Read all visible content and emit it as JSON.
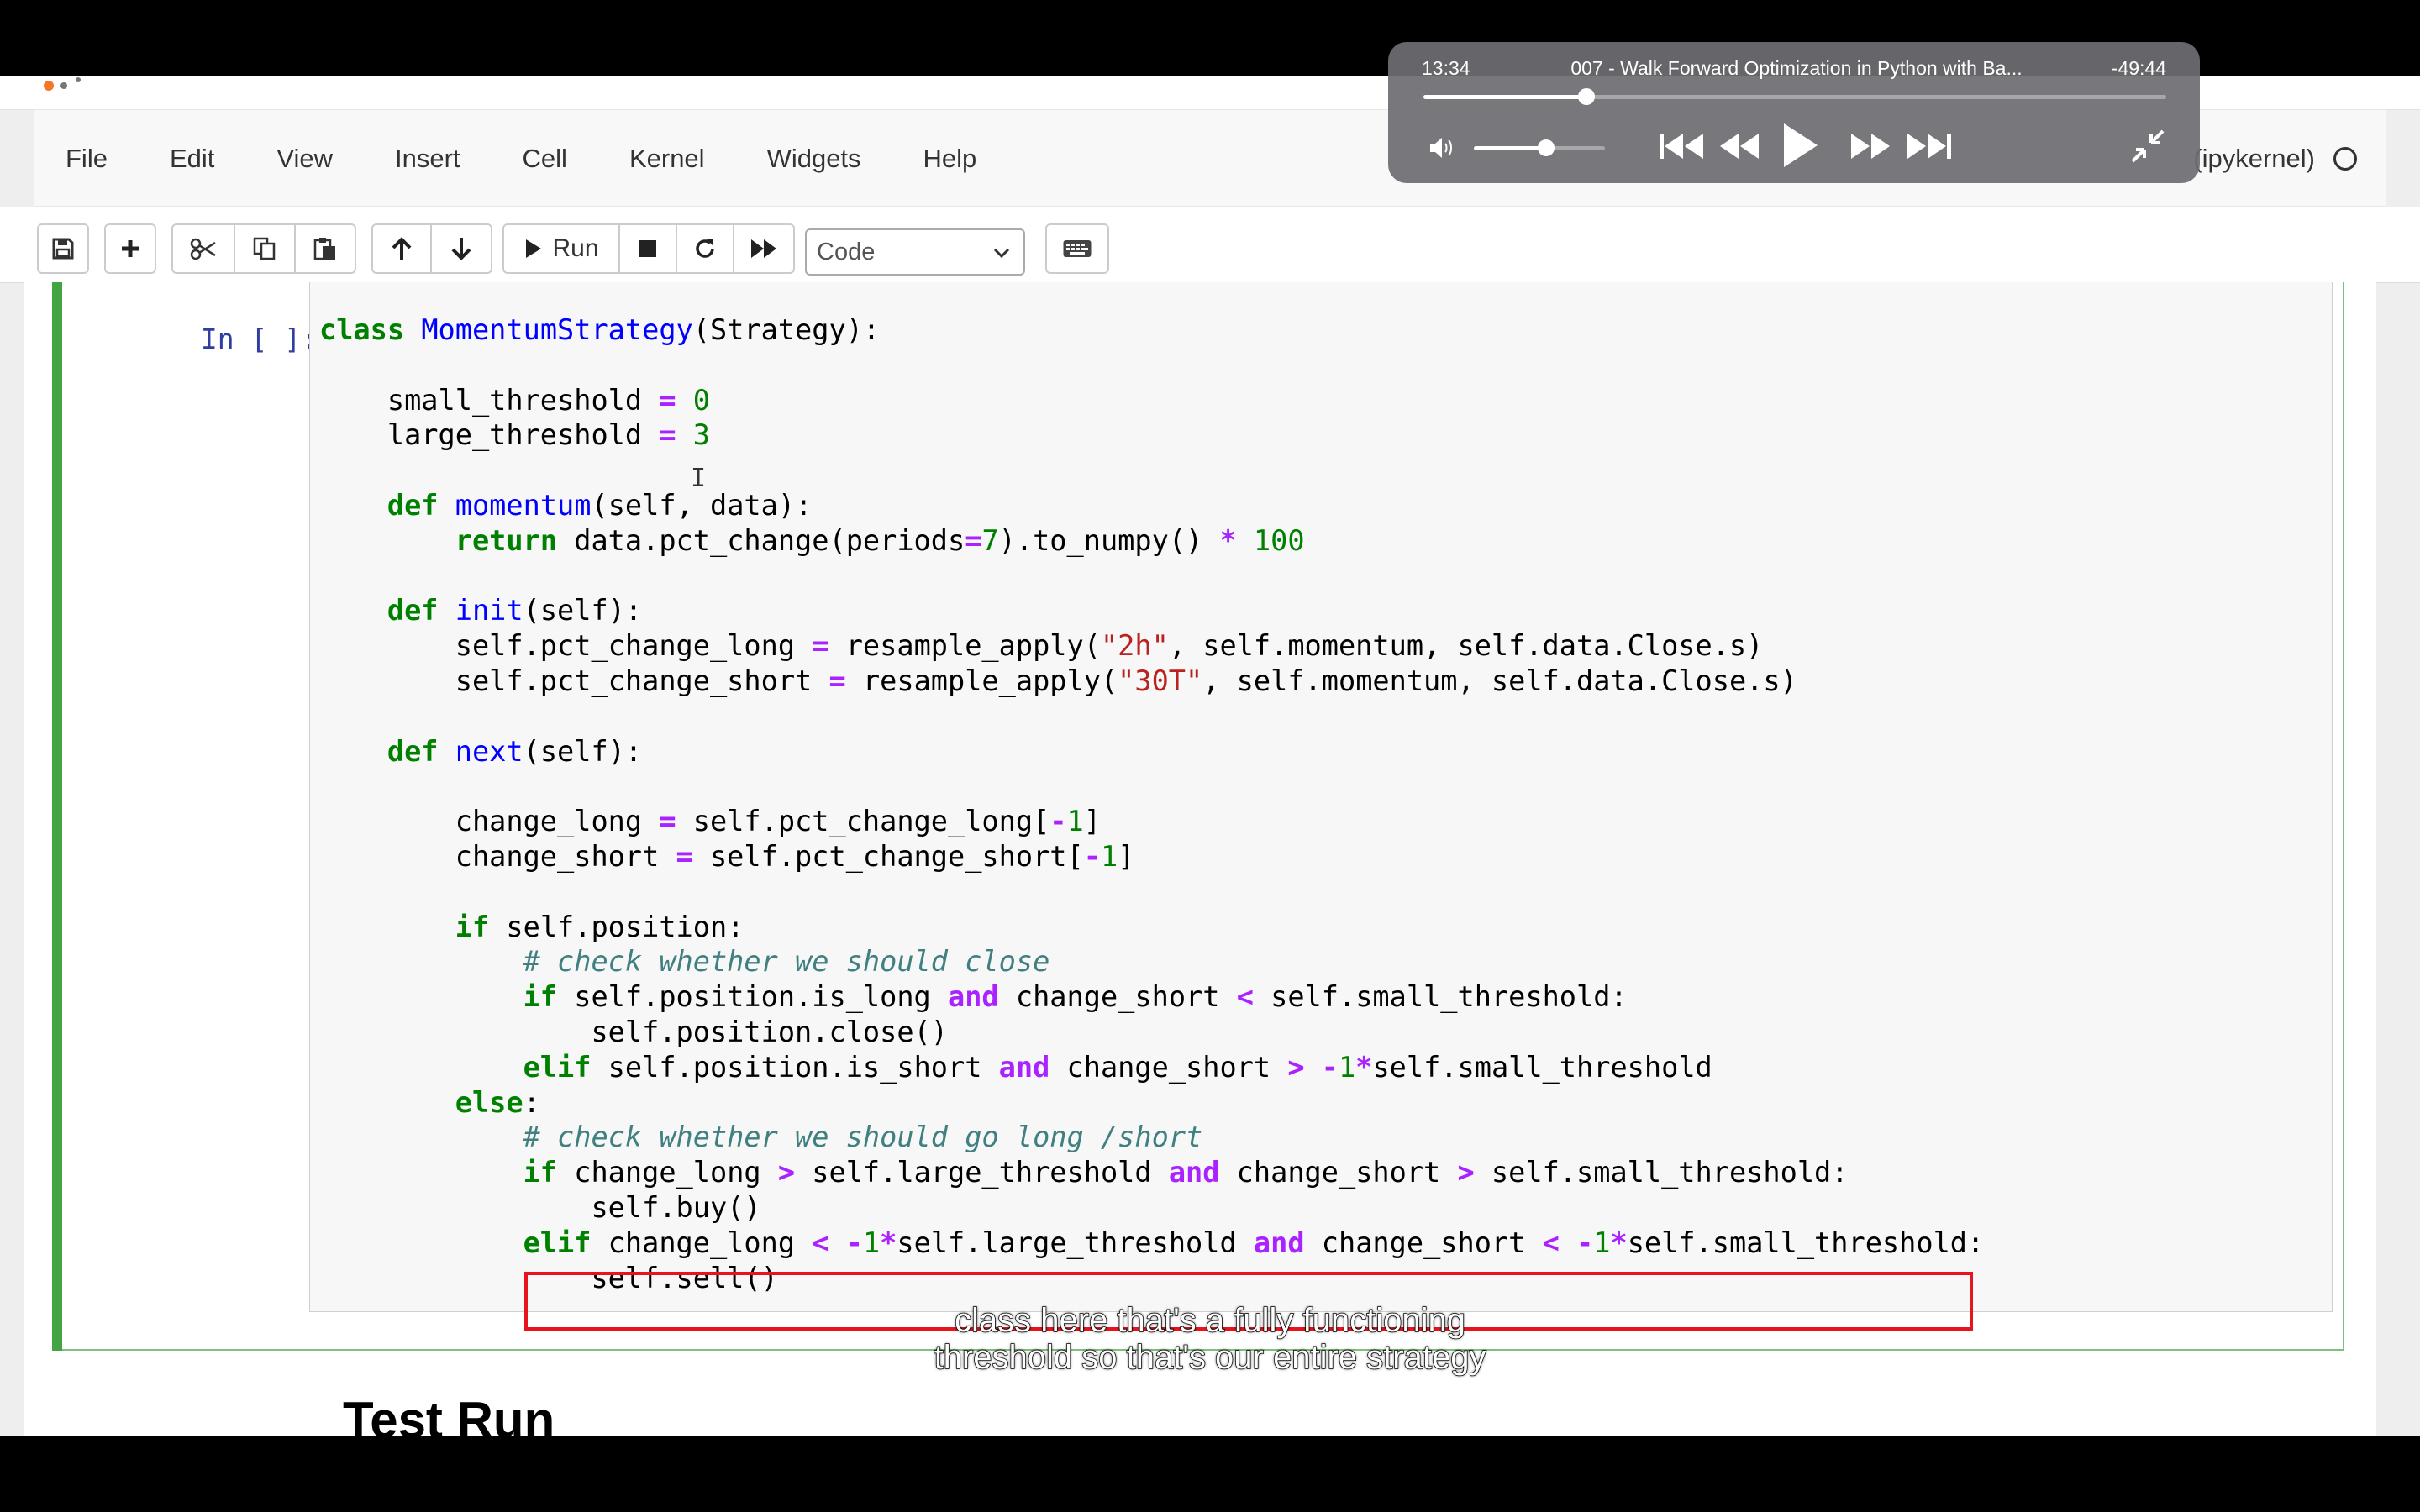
{
  "menu": [
    "File",
    "Edit",
    "View",
    "Insert",
    "Cell",
    "Kernel",
    "Widgets",
    "Help"
  ],
  "kernel": {
    "label": "(ipykernel)"
  },
  "toolbar": {
    "run_label": "Run",
    "cell_type": "Code",
    "icons": [
      "save-icon",
      "add-cell-icon",
      "cut-icon",
      "copy-icon",
      "paste-icon",
      "move-up-icon",
      "move-down-icon",
      "run-icon",
      "stop-icon",
      "restart-icon",
      "fast-forward-icon",
      "keyboard-icon"
    ]
  },
  "cell": {
    "prompt": "In [ ]:",
    "lines": [
      [
        [
          "kw",
          "class"
        ],
        [
          "t",
          " "
        ],
        [
          "fn",
          "MomentumStrategy"
        ],
        [
          "t",
          "(Strategy):"
        ]
      ],
      [],
      [
        [
          "t",
          "    small_threshold "
        ],
        [
          "op",
          "="
        ],
        [
          "t",
          " "
        ],
        [
          "num",
          "0"
        ]
      ],
      [
        [
          "t",
          "    large_threshold "
        ],
        [
          "op",
          "="
        ],
        [
          "t",
          " "
        ],
        [
          "num",
          "3"
        ]
      ],
      [],
      [
        [
          "t",
          "    "
        ],
        [
          "kw",
          "def"
        ],
        [
          "t",
          " "
        ],
        [
          "fn",
          "momentum"
        ],
        [
          "t",
          "(self, data):"
        ]
      ],
      [
        [
          "t",
          "        "
        ],
        [
          "kw",
          "return"
        ],
        [
          "t",
          " data.pct_change(periods"
        ],
        [
          "op",
          "="
        ],
        [
          "num",
          "7"
        ],
        [
          "t",
          ").to_numpy() "
        ],
        [
          "op",
          "*"
        ],
        [
          "t",
          " "
        ],
        [
          "num",
          "100"
        ]
      ],
      [],
      [
        [
          "t",
          "    "
        ],
        [
          "kw",
          "def"
        ],
        [
          "t",
          " "
        ],
        [
          "fn",
          "init"
        ],
        [
          "t",
          "(self):"
        ]
      ],
      [
        [
          "t",
          "        self.pct_change_long "
        ],
        [
          "op",
          "="
        ],
        [
          "t",
          " resample_apply("
        ],
        [
          "str",
          "\"2h\""
        ],
        [
          "t",
          ", self.momentum, self.data.Close.s)"
        ]
      ],
      [
        [
          "t",
          "        self.pct_change_short "
        ],
        [
          "op",
          "="
        ],
        [
          "t",
          " resample_apply("
        ],
        [
          "str",
          "\"30T\""
        ],
        [
          "t",
          ", self.momentum, self.data.Close.s)"
        ]
      ],
      [],
      [
        [
          "t",
          "    "
        ],
        [
          "kw",
          "def"
        ],
        [
          "t",
          " "
        ],
        [
          "fn",
          "next"
        ],
        [
          "t",
          "(self):"
        ]
      ],
      [],
      [
        [
          "t",
          "        change_long "
        ],
        [
          "op",
          "="
        ],
        [
          "t",
          " self.pct_change_long["
        ],
        [
          "op",
          "-"
        ],
        [
          "num",
          "1"
        ],
        [
          "t",
          "]"
        ]
      ],
      [
        [
          "t",
          "        change_short "
        ],
        [
          "op",
          "="
        ],
        [
          "t",
          " self.pct_change_short["
        ],
        [
          "op",
          "-"
        ],
        [
          "num",
          "1"
        ],
        [
          "t",
          "]"
        ]
      ],
      [],
      [
        [
          "t",
          "        "
        ],
        [
          "kw",
          "if"
        ],
        [
          "t",
          " self.position:"
        ]
      ],
      [
        [
          "t",
          "            "
        ],
        [
          "cm",
          "# check whether we should close"
        ]
      ],
      [
        [
          "t",
          "            "
        ],
        [
          "kw",
          "if"
        ],
        [
          "t",
          " self.position.is_long "
        ],
        [
          "op",
          "and"
        ],
        [
          "t",
          " change_short "
        ],
        [
          "op",
          "<"
        ],
        [
          "t",
          " self.small_threshold:"
        ]
      ],
      [
        [
          "t",
          "                self.position.close()"
        ]
      ],
      [
        [
          "t",
          "            "
        ],
        [
          "kw",
          "elif"
        ],
        [
          "t",
          " self.position.is_short "
        ],
        [
          "op",
          "and"
        ],
        [
          "t",
          " change_short "
        ],
        [
          "op",
          ">"
        ],
        [
          "t",
          " "
        ],
        [
          "op",
          "-"
        ],
        [
          "num",
          "1"
        ],
        [
          "op",
          "*"
        ],
        [
          "t",
          "self.small_threshold"
        ]
      ],
      [
        [
          "t",
          "        "
        ],
        [
          "kw",
          "else"
        ],
        [
          "t",
          ":"
        ]
      ],
      [
        [
          "t",
          "            "
        ],
        [
          "cm",
          "# check whether we should go long /short"
        ]
      ],
      [
        [
          "t",
          "            "
        ],
        [
          "kw",
          "if"
        ],
        [
          "t",
          " change_long "
        ],
        [
          "op",
          ">"
        ],
        [
          "t",
          " self.large_threshold "
        ],
        [
          "op",
          "and"
        ],
        [
          "t",
          " change_short "
        ],
        [
          "op",
          ">"
        ],
        [
          "t",
          " self.small_threshold:"
        ]
      ],
      [
        [
          "t",
          "                self.buy()"
        ]
      ],
      [
        [
          "t",
          "            "
        ],
        [
          "kw",
          "elif"
        ],
        [
          "t",
          " change_long "
        ],
        [
          "op",
          "<"
        ],
        [
          "t",
          " "
        ],
        [
          "op",
          "-"
        ],
        [
          "num",
          "1"
        ],
        [
          "op",
          "*"
        ],
        [
          "t",
          "self.large_threshold "
        ],
        [
          "op",
          "and"
        ],
        [
          "t",
          " change_short "
        ],
        [
          "op",
          "<"
        ],
        [
          "t",
          " "
        ],
        [
          "op",
          "-"
        ],
        [
          "num",
          "1"
        ],
        [
          "op",
          "*"
        ],
        [
          "t",
          "self.small_threshold:"
        ]
      ],
      [
        [
          "t",
          "                self.sell()"
        ]
      ]
    ]
  },
  "markdown": {
    "heading": "Test Run"
  },
  "subtitle": {
    "line1": "class here that's a fully functioning",
    "line2": "threshold so that's our entire strategy"
  },
  "player": {
    "elapsed": "13:34",
    "title": "007 - Walk Forward Optimization in Python with Ba...",
    "remaining": "-49:44",
    "progress": 0.22,
    "volume": 0.55,
    "icons": [
      "volume-icon",
      "skip-back-icon",
      "rewind-icon",
      "play-icon",
      "fast-forward-icon",
      "skip-forward-icon",
      "exit-fullscreen-icon"
    ]
  },
  "colors": {
    "cell_border": "#42a542",
    "highlight_box": "#e8141b",
    "prompt": "#303f9f",
    "keyword": "#008000",
    "function": "#0000ff",
    "operator": "#aa22ff",
    "string": "#ba2121",
    "comment": "#408080"
  }
}
